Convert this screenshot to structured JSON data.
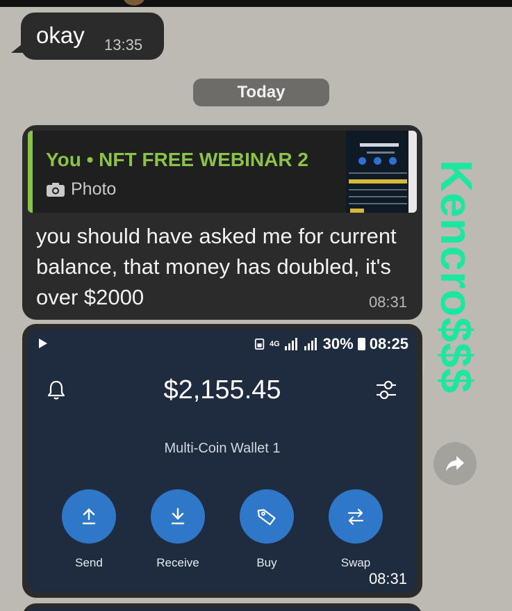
{
  "messages": {
    "okay": {
      "text": "okay",
      "time": "13:35"
    },
    "date_separator": "Today",
    "reply": {
      "quote_title": "You • NFT FREE WEBINAR 2",
      "quote_type": "Photo",
      "text": "you should have asked me for current balance, that money has doubled, it's over $2000",
      "time": "08:31"
    },
    "image": {
      "time": "08:31",
      "screenshot": {
        "status_network": "4G",
        "status_battery": "30%",
        "status_time": "08:25",
        "balance": "$2,155.45",
        "wallet_name": "Multi-Coin Wallet 1",
        "actions": [
          {
            "label": "Send",
            "icon": "arrow-up-icon"
          },
          {
            "label": "Receive",
            "icon": "arrow-down-icon"
          },
          {
            "label": "Buy",
            "icon": "tag-icon"
          },
          {
            "label": "Swap",
            "icon": "swap-icon"
          }
        ]
      }
    }
  },
  "watermark": "Kencro$$$",
  "colors": {
    "quote_accent": "#8bc34a",
    "watermark": "#1de6a0",
    "action_blue": "#2f78c9",
    "wallet_bg": "#1f2c3f"
  }
}
